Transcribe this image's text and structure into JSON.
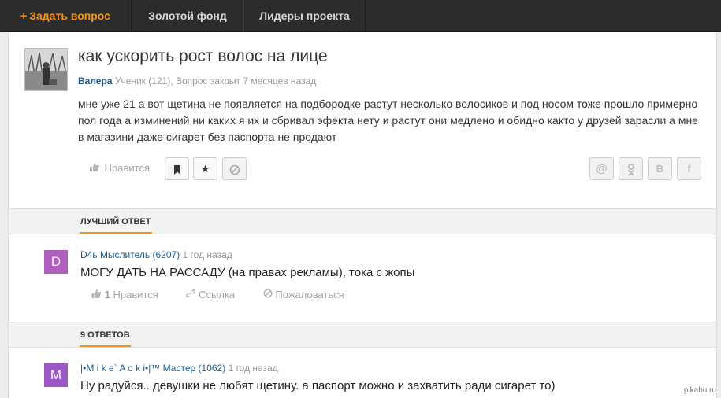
{
  "topnav": {
    "ask_plus": "+",
    "ask_label": "Задать вопрос",
    "gold_label": "Золотой фонд",
    "leaders_label": "Лидеры проекта"
  },
  "question": {
    "title": "как ускорить рост волос на лице",
    "author": "Валера",
    "meta": "Ученик (121), Вопрос закрыт 7 месяцев назад",
    "body": "мне уже 21 а вот щетина не появляется на подбородке растут несколько волосиков и под носом тоже прошло примерно пол года а изминений ни каких я их и сбривал эфекта нету и растут они медлено и обидно както у друзей зарасли а мне в магазини даже сигарет без паспорта не продают",
    "like_label": "Нравится",
    "like_icon": "thumbs-up-icon",
    "action_icons": [
      "bookmark-icon",
      "star-icon",
      "block-icon"
    ],
    "share": {
      "mail": "@",
      "ok": "ок",
      "vk": "B",
      "fb": "f"
    }
  },
  "best_answer": {
    "section_label": "ЛУЧШИЙ ОТВЕТ",
    "avatar_letter": "D",
    "avatar_color": "#b05fc0",
    "author": "D4ь",
    "rank": "Мыслитель (6207)",
    "time": "1 год назад",
    "text": "МОГУ ДАТЬ НА РАССАДУ (на правах рекламы), тока с жопы",
    "likes_count": "1",
    "like_label": "Нравится",
    "link_label": "Ссылка",
    "report_label": "Пожаловаться"
  },
  "answers": {
    "section_label": "9 ОТВЕТОВ",
    "first": {
      "avatar_letter": "M",
      "avatar_color": "#9b59c8",
      "author": "|•M i k e` A o k i•|™",
      "rank": "Мастер (1062)",
      "time": "1 год назад",
      "text": "Ну радуйся.. девушки не любят щетину. а паспорт можно и захватить ради сигарет то)"
    }
  },
  "watermark": "pikabu.ru"
}
